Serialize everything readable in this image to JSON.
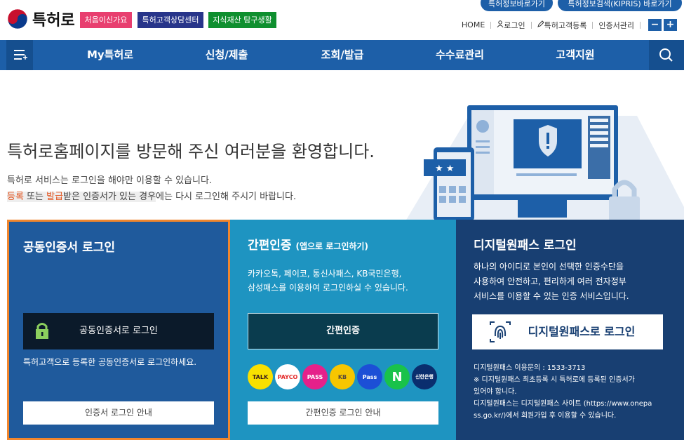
{
  "top_links": {
    "patent_info": "특허정보바로가기",
    "kipris": "특허정보검색(KIPRIS) 바로가기"
  },
  "header": {
    "logo_text": "특허로",
    "badges": [
      "처음이신가요",
      "특허고객상담센터",
      "지식재산 탐구생활"
    ],
    "util": {
      "home": "HOME",
      "login": "로그인",
      "register": "특허고객등록",
      "cert": "인증서관리",
      "zoom_out": "−",
      "zoom_in": "+"
    }
  },
  "nav": {
    "items": [
      "My특허로",
      "신청/제출",
      "조회/발급",
      "수수료관리",
      "고객지원"
    ]
  },
  "welcome": {
    "title": "특허로홈페이지를 방문해 주신 여러분을 환영합니다.",
    "line1": "특허로 서비스는 로그인을 해야만 이용할 수 있습니다.",
    "line2_reg": "등록",
    "line2_or": " 또는 ",
    "line2_issue": "발급",
    "line2_mid": "받은 인증서가 있는 경우",
    "line2_end": "에는 다시 로그인해 주시기 바랍니다."
  },
  "panels": {
    "joint": {
      "title": "공동인증서 로그인",
      "login_button": "공동인증서로 로그인",
      "desc": "특허고객으로 등록한 공동인증서로 로그인하세요.",
      "guide_button": "인증서 로그인 안내"
    },
    "simple": {
      "title": "간편인증",
      "subtitle": "(앱으로 로그인하기)",
      "desc1": "카카오톡, 페이코, 통신사패스, KB국민은행,",
      "desc2": "삼성패스를 이용하여 로그인하실 수 있습니다.",
      "auth_button": "간편인증",
      "guide_button": "간편인증 로그인 안내",
      "apps": [
        "TALK",
        "PAYCO",
        "PASS",
        "KB",
        "Pass",
        "N",
        "신한은행"
      ]
    },
    "onepass": {
      "title": "디지털원패스 로그인",
      "desc1": "하나의 아이디로 본인이 선택한 인증수단을",
      "desc2": "사용하여 안전하고, 편리하게 여러 전자정부",
      "desc3": "서비스를 이용할 수 있는 인증 서비스입니다.",
      "login_button": "디지털원패스로 로그인",
      "info1": "디지털원패스 이용문의 : 1533-3713",
      "info2": "※ 디지털원패스 최초등록 시 특허로에 등록된 인증서가",
      "info3": "있어야 합니다.",
      "info4": "디지털원패스는 디지털원패스 사이트 (https://www.onepa",
      "info5": "ss.go.kr/)에서 회원가입 후 이용할 수 있습니다."
    }
  },
  "colors": {
    "primary": "#1d5fa8",
    "orange_border": "#f1862d",
    "teal": "#1e94c1",
    "navy": "#183f72"
  }
}
